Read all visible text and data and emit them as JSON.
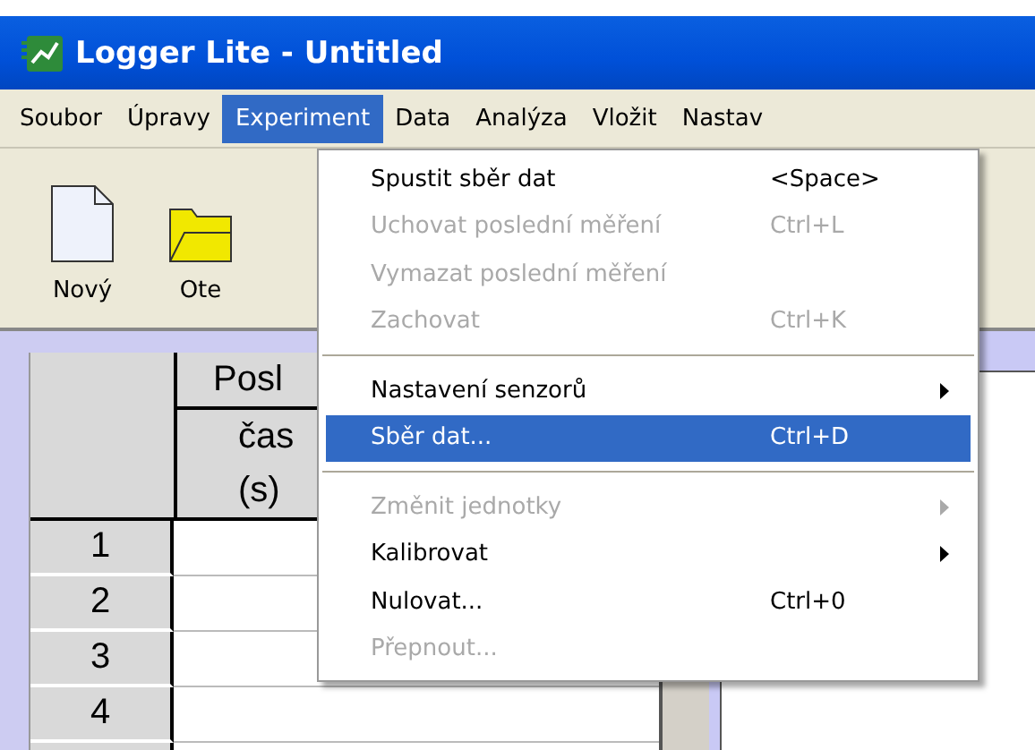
{
  "window": {
    "title": "Logger Lite - Untitled"
  },
  "menu_bar": [
    {
      "label": "Soubor",
      "selected": false
    },
    {
      "label": "Úpravy",
      "selected": false
    },
    {
      "label": "Experiment",
      "selected": true
    },
    {
      "label": "Data",
      "selected": false
    },
    {
      "label": "Analýza",
      "selected": false
    },
    {
      "label": "Vložit",
      "selected": false
    },
    {
      "label": "Nastav",
      "selected": false
    }
  ],
  "toolbar": [
    {
      "kind": "document",
      "label": "Nový"
    },
    {
      "kind": "folder",
      "label": "Ote"
    }
  ],
  "table": {
    "header_lines": [
      "Posl",
      "čas",
      "(s)"
    ],
    "row_numbers": [
      "1",
      "2",
      "3",
      "4"
    ]
  },
  "dropdown": [
    {
      "kind": "item",
      "label": "Spustit sběr dat",
      "shortcut": "<Space>",
      "disabled": false,
      "submenu": false,
      "selected": false
    },
    {
      "kind": "item",
      "label": "Uchovat poslední měření",
      "shortcut": "Ctrl+L",
      "disabled": true,
      "submenu": false,
      "selected": false
    },
    {
      "kind": "item",
      "label": "Vymazat poslední měření",
      "disabled": true,
      "submenu": false,
      "selected": false
    },
    {
      "kind": "item",
      "label": "Zachovat",
      "shortcut": "Ctrl+K",
      "disabled": true,
      "submenu": false,
      "selected": false
    },
    {
      "kind": "separator"
    },
    {
      "kind": "item",
      "label": "Nastavení senzorů",
      "disabled": false,
      "submenu": true,
      "selected": false
    },
    {
      "kind": "item",
      "label": "Sběr dat...",
      "shortcut": "Ctrl+D",
      "disabled": false,
      "submenu": false,
      "selected": true
    },
    {
      "kind": "separator"
    },
    {
      "kind": "item",
      "label": "Změnit jednotky",
      "disabled": true,
      "submenu": true,
      "selected": false
    },
    {
      "kind": "item",
      "label": "Kalibrovat",
      "disabled": false,
      "submenu": true,
      "selected": false
    },
    {
      "kind": "item",
      "label": "Nulovat...",
      "shortcut": "Ctrl+0",
      "disabled": false,
      "submenu": false,
      "selected": false
    },
    {
      "kind": "item",
      "label": "Přepnout...",
      "disabled": true,
      "submenu": false,
      "selected": false
    }
  ]
}
